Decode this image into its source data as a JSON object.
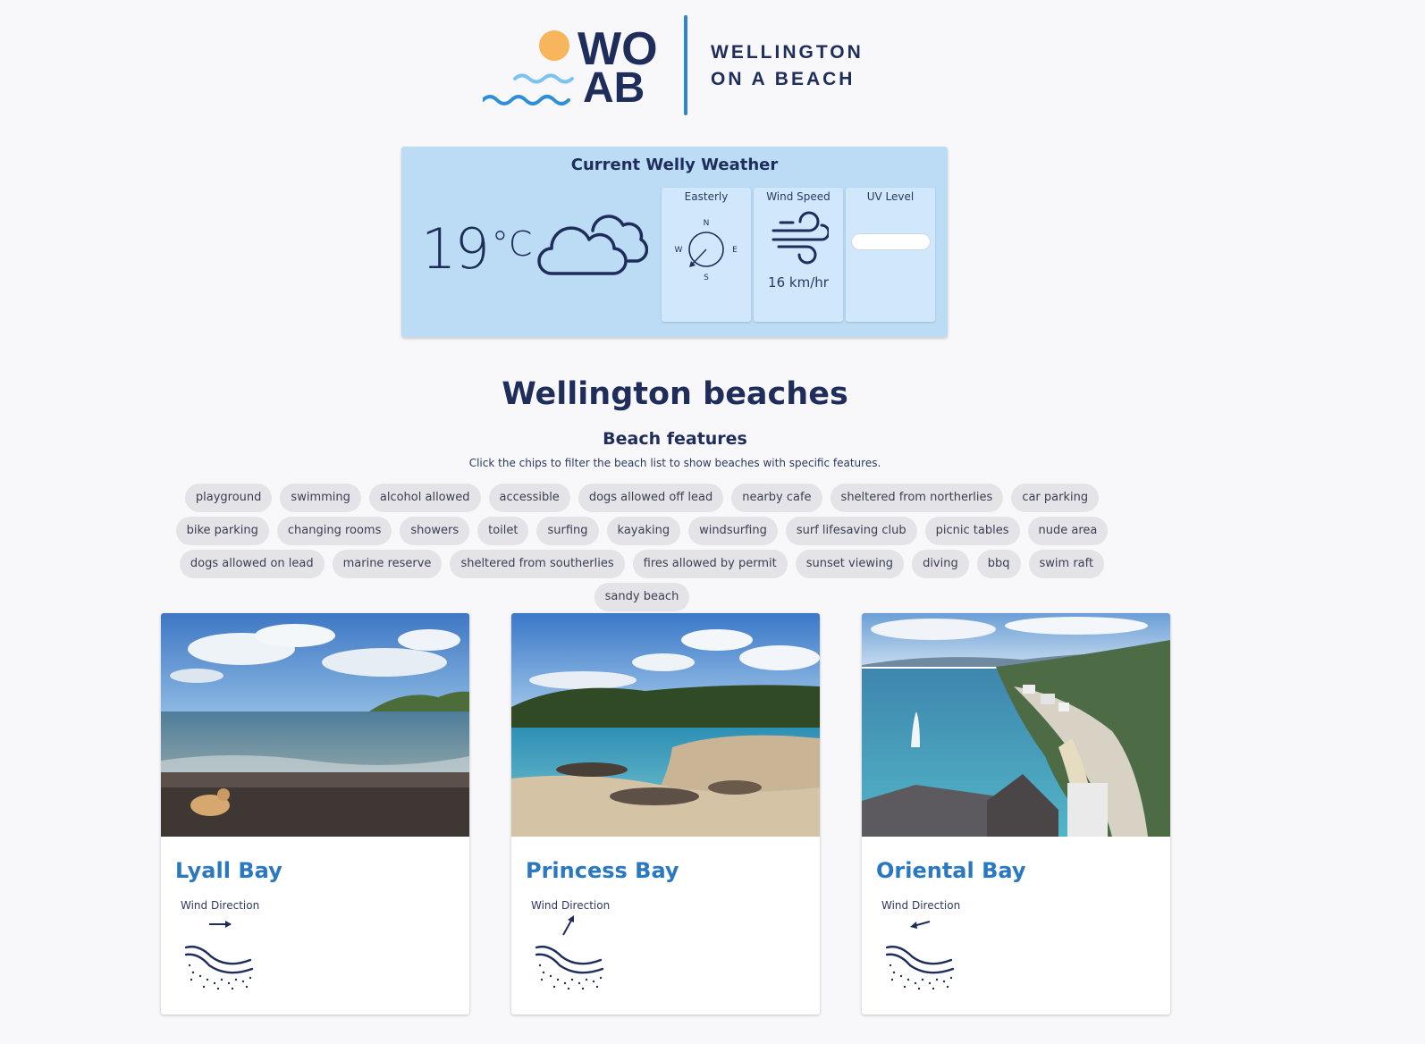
{
  "header": {
    "logo_line1": "WELLINGTON",
    "logo_line2": "ON A BEACH",
    "logo_mark_letters": "WOAB",
    "accent_navy": "#1f2d5a",
    "accent_blue": "#2f86cc",
    "sun_color": "#f7b55c"
  },
  "weather": {
    "title": "Current Welly Weather",
    "temperature": "19",
    "unit": "°C",
    "condition_icon": "cloud-icon",
    "wind_direction_label": "Easterly",
    "compass": {
      "n": "N",
      "e": "E",
      "s": "S",
      "w": "W"
    },
    "wind_speed_label": "Wind Speed",
    "wind_speed_value": "16 km/hr",
    "uv_label": "UV Level",
    "uv_level_fraction": 0
  },
  "main": {
    "title": "Wellington beaches",
    "features_title": "Beach features",
    "features_help": "Click the chips to filter the beach list to show beaches with specific features.",
    "chips": [
      "playground",
      "swimming",
      "alcohol allowed",
      "accessible",
      "dogs allowed off lead",
      "nearby cafe",
      "sheltered from northerlies",
      "car parking",
      "bike parking",
      "changing rooms",
      "showers",
      "toilet",
      "surfing",
      "kayaking",
      "windsurfing",
      "surf lifesaving club",
      "picnic tables",
      "nude area",
      "dogs allowed on lead",
      "marine reserve",
      "sheltered from southerlies",
      "fires allowed by permit",
      "sunset viewing",
      "diving",
      "bbq",
      "swim raft",
      "sandy beach"
    ]
  },
  "beaches": [
    {
      "name": "Lyall Bay",
      "wind_label": "Wind Direction",
      "arrow_icon": "arrow-east-icon"
    },
    {
      "name": "Princess Bay",
      "wind_label": "Wind Direction",
      "arrow_icon": "arrow-northeast-icon"
    },
    {
      "name": "Oriental Bay",
      "wind_label": "Wind Direction",
      "arrow_icon": "arrow-west-icon"
    }
  ]
}
